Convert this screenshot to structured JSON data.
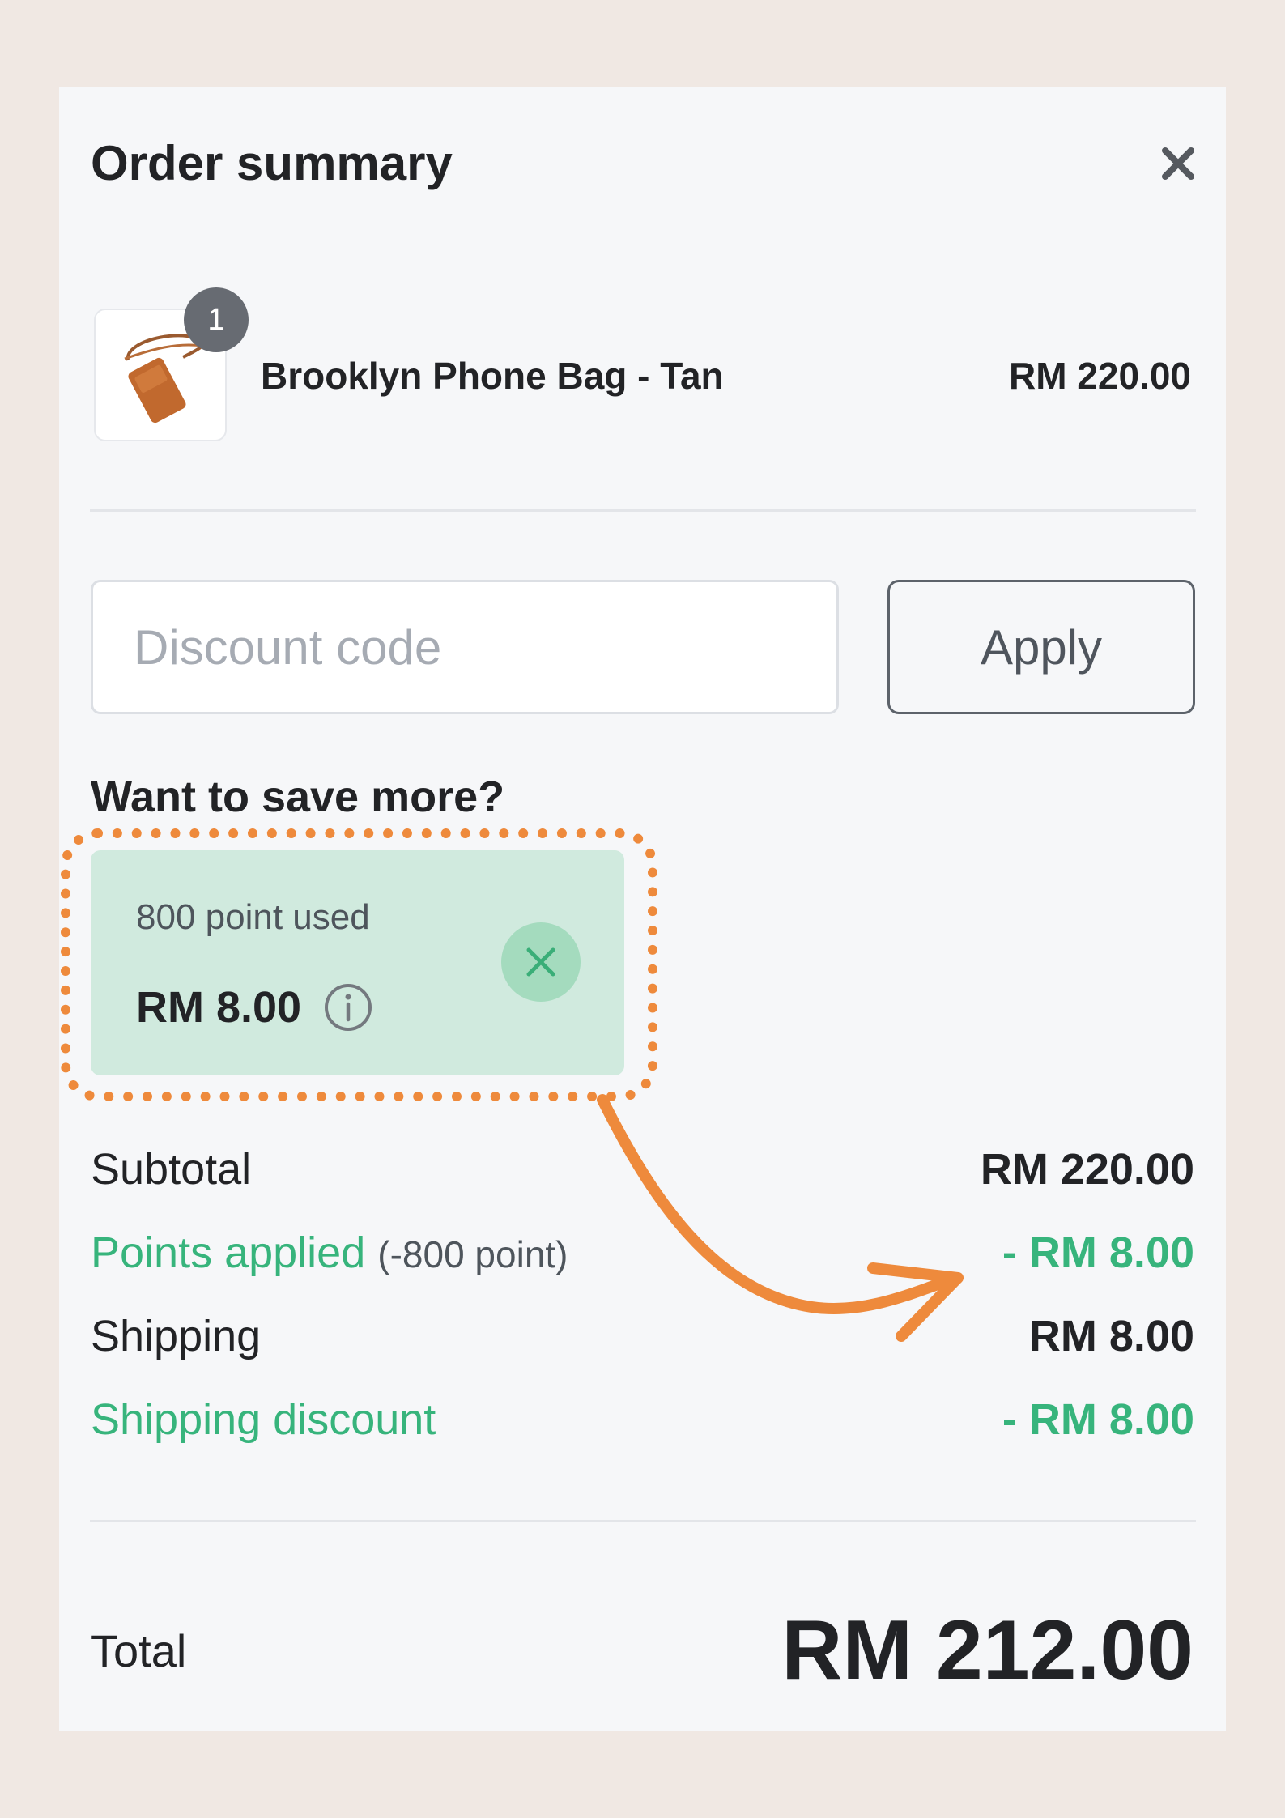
{
  "header": {
    "title": "Order summary",
    "close_icon": "close-icon"
  },
  "product": {
    "quantity": "1",
    "name": "Brooklyn Phone Bag - Tan",
    "price": "RM 220.00",
    "image_icon": "tan-phone-bag-image"
  },
  "discount": {
    "placeholder": "Discount code",
    "value": "",
    "apply_label": "Apply"
  },
  "points": {
    "heading": "Want to save more?",
    "used_text": "800 point used",
    "amount": "RM 8.00",
    "info_icon": "info-icon",
    "remove_icon": "remove-icon"
  },
  "summary": {
    "subtotal_label": "Subtotal",
    "subtotal_value": "RM 220.00",
    "points_applied_label": "Points applied",
    "points_applied_detail": "(-800 point)",
    "points_applied_value": "- RM 8.00",
    "shipping_label": "Shipping",
    "shipping_value": "RM 8.00",
    "shipping_discount_label": "Shipping discount",
    "shipping_discount_value": "- RM 8.00",
    "total_label": "Total",
    "total_value": "RM 212.00"
  },
  "colors": {
    "page_background": "#f0e8e3",
    "panel_background": "#f6f7f9",
    "accent_green": "#37b47c",
    "points_card_background": "#d0eade",
    "highlight_orange": "#ee8a3c"
  }
}
